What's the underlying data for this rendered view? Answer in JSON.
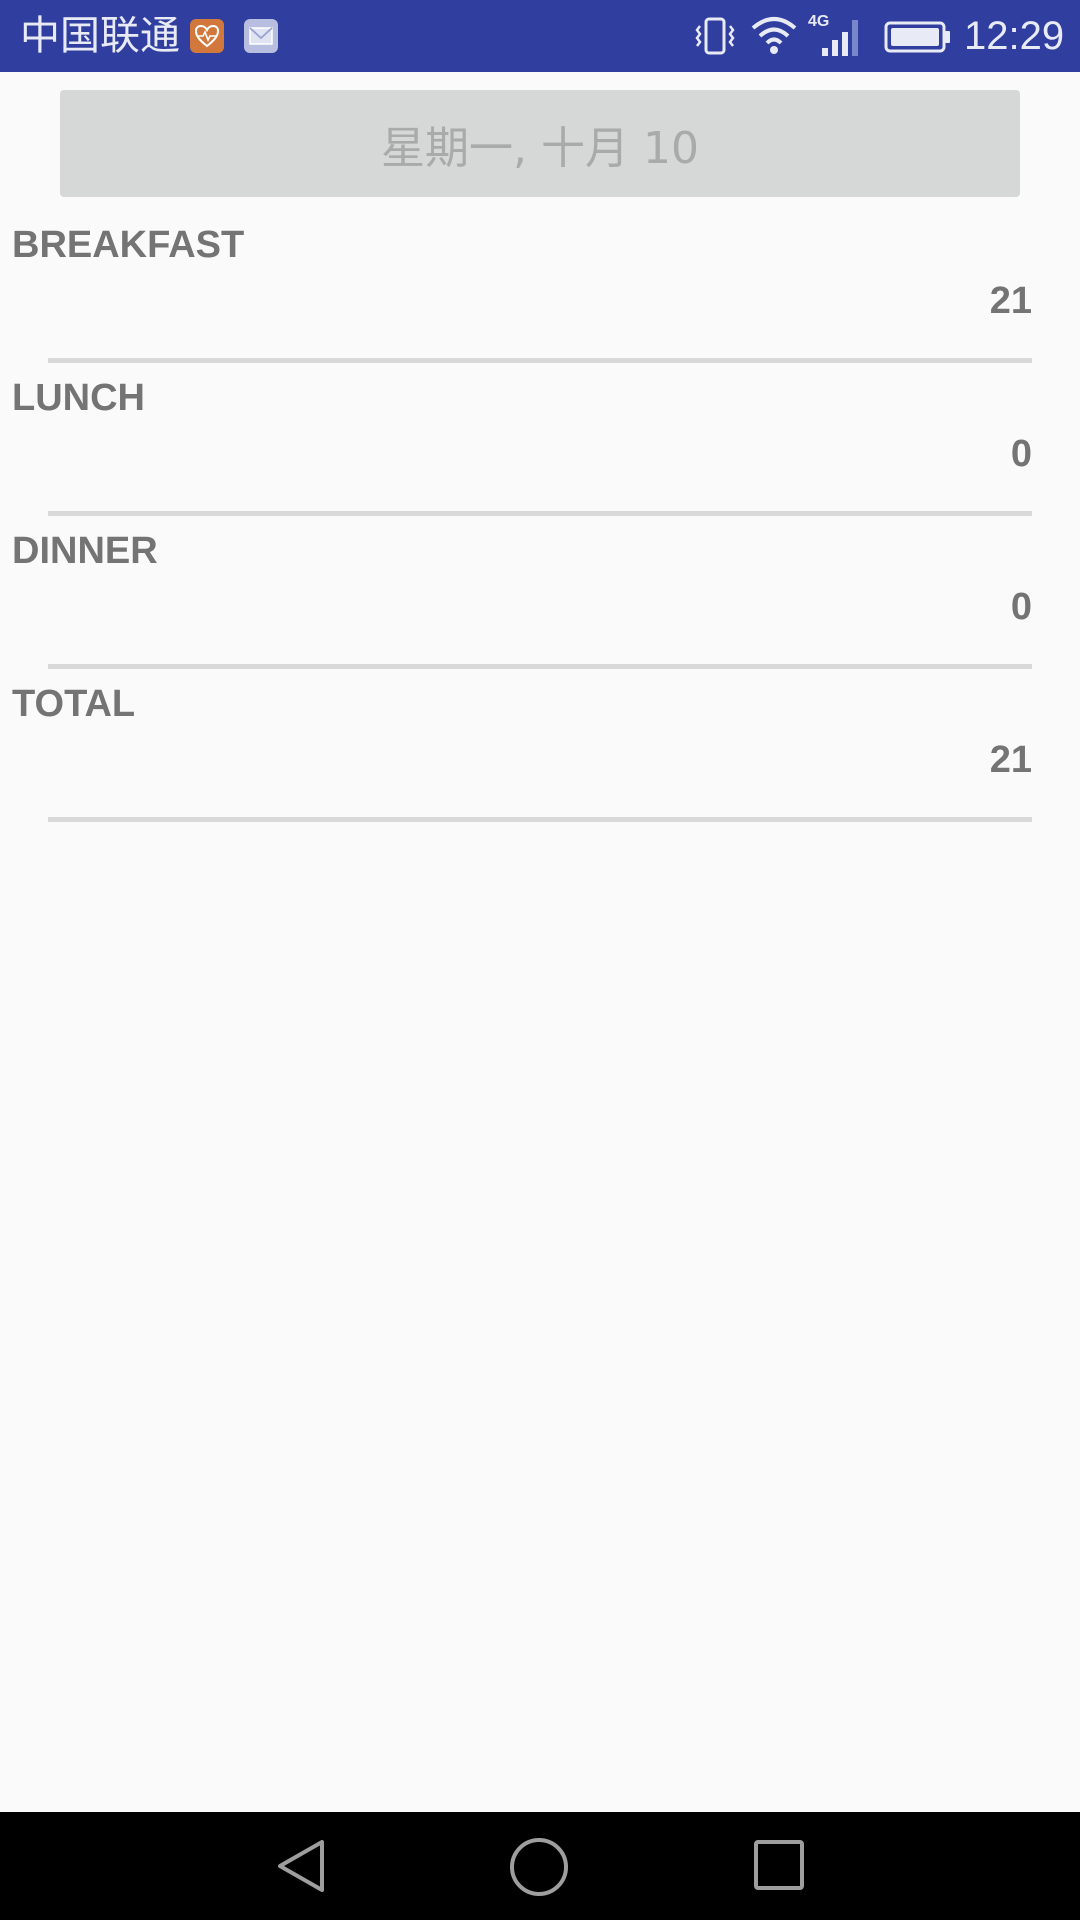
{
  "status_bar": {
    "carrier": "中国联通",
    "network": "4G",
    "time": "12:29",
    "background_color": "#303f9f"
  },
  "date_button": {
    "label": "星期一, 十月 10"
  },
  "meals": [
    {
      "label": "BREAKFAST",
      "value": "21"
    },
    {
      "label": "LUNCH",
      "value": "0"
    },
    {
      "label": "DINNER",
      "value": "0"
    },
    {
      "label": "TOTAL",
      "value": "21"
    }
  ],
  "icons": {
    "notification_1": "health-app-icon",
    "notification_2": "mail-icon",
    "vibrate": "vibrate-icon",
    "wifi": "wifi-icon",
    "signal": "signal-icon",
    "battery": "battery-icon",
    "nav_back": "back-icon",
    "nav_home": "home-icon",
    "nav_recent": "recent-apps-icon"
  }
}
